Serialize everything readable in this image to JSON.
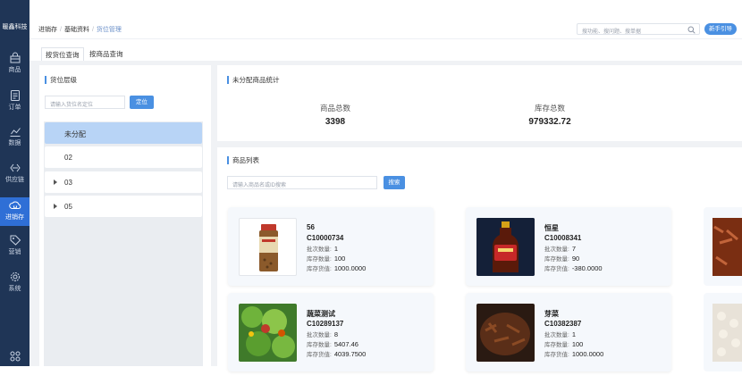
{
  "brand": "暖鑫科技",
  "sidebar": {
    "items": [
      {
        "label": "商品",
        "icon": "bag-icon"
      },
      {
        "label": "订单",
        "icon": "document-icon"
      },
      {
        "label": "数据",
        "icon": "chart-line-icon"
      },
      {
        "label": "供应链",
        "icon": "exchange-icon"
      },
      {
        "label": "进销存",
        "icon": "cloud-refresh-icon",
        "active": true
      },
      {
        "label": "营销",
        "icon": "tag-icon"
      },
      {
        "label": "系统",
        "icon": "gear-icon"
      }
    ]
  },
  "breadcrumb": [
    "进销存",
    "基础资料",
    "货位管理"
  ],
  "header": {
    "search_placeholder": "搜功能、搜问题、搜单据",
    "guide_button": "新手引导"
  },
  "tabs": [
    "按货位查询",
    "按商品查询"
  ],
  "left": {
    "section_title": "货位层级",
    "input_placeholder": "请输入货位名定位",
    "locate_button": "定位",
    "tree": [
      {
        "name": "未分配",
        "selected": true,
        "expandable": false
      },
      {
        "name": "02",
        "selected": false,
        "expandable": false
      },
      {
        "name": "03",
        "selected": false,
        "expandable": true
      },
      {
        "name": "05",
        "selected": false,
        "expandable": true
      }
    ]
  },
  "stats": {
    "section_title": "未分配商品统计",
    "total_goods_label": "商品总数",
    "total_goods_value": "3398",
    "total_stock_label": "库存总数",
    "total_stock_value": "979332.72"
  },
  "product_list": {
    "section_title": "商品列表",
    "input_placeholder": "请输入商品名或ID搜索",
    "search_button": "搜索",
    "batch_label": "批次数量:",
    "stock_label": "库存数量:",
    "value_label": "库存货值:",
    "cards": [
      {
        "name": "56",
        "code": "C10000734",
        "batch": "1",
        "stock": "100",
        "value": "1000.0000",
        "image": "spice-jar"
      },
      {
        "name": "恒星",
        "code": "C10008341",
        "batch": "7",
        "stock": "90",
        "value": "-380.0000",
        "image": "oil-bottle"
      },
      {
        "name": "蔬菜测试",
        "code": "C10289137",
        "batch": "8",
        "stock": "5407.46",
        "value": "4039.7500",
        "image": "salad"
      },
      {
        "name": "芽菜",
        "code": "C10382387",
        "batch": "1",
        "stock": "100",
        "value": "1000.0000",
        "image": "preserved-veg"
      }
    ]
  }
}
